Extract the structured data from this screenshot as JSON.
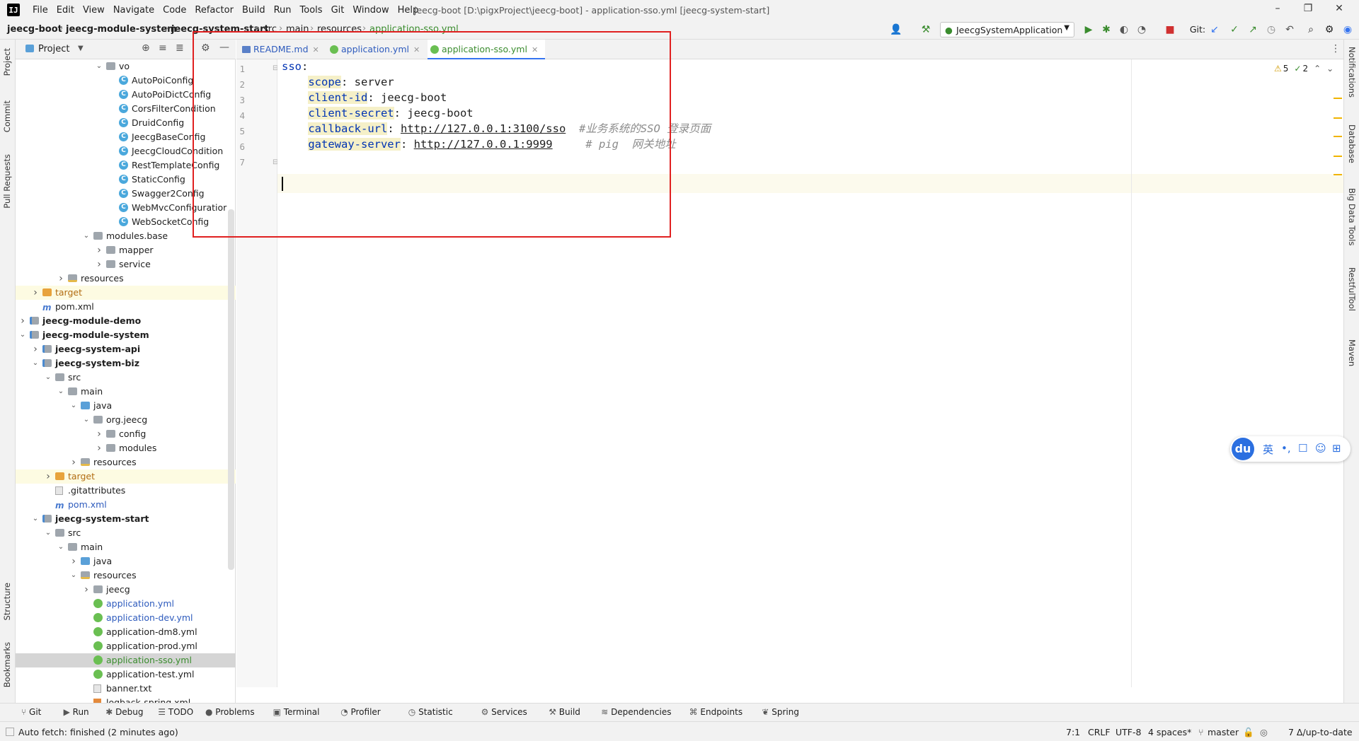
{
  "menu": [
    "File",
    "Edit",
    "View",
    "Navigate",
    "Code",
    "Refactor",
    "Build",
    "Run",
    "Tools",
    "Git",
    "Window",
    "Help"
  ],
  "window_title": "jeecg-boot [D:\\pigxProject\\jeecg-boot] - application-sso.yml [jeecg-system-start]",
  "breadcrumbs": [
    "jeecg-boot",
    "jeecg-module-system",
    "jeecg-system-start",
    "src",
    "main",
    "resources",
    "application-sso.yml"
  ],
  "run_config": "JeecgSystemApplication",
  "git_label": "Git:",
  "left_tools": [
    "Project",
    "Commit",
    "Pull Requests",
    "Structure",
    "Bookmarks"
  ],
  "right_tools": [
    "Notifications",
    "Database",
    "Big Data Tools",
    "RestfulTool",
    "Maven"
  ],
  "project_panel": {
    "title": "Project"
  },
  "tree": [
    {
      "label": "vo",
      "depth": 7,
      "icon": "folder",
      "arrow": "open",
      "style": ""
    },
    {
      "label": "AutoPoiConfig",
      "depth": 8,
      "icon": "class",
      "arrow": "",
      "style": ""
    },
    {
      "label": "AutoPoiDictConfig",
      "depth": 8,
      "icon": "class",
      "arrow": "",
      "style": ""
    },
    {
      "label": "CorsFilterCondition",
      "depth": 8,
      "icon": "class",
      "arrow": "",
      "style": ""
    },
    {
      "label": "DruidConfig",
      "depth": 8,
      "icon": "class",
      "arrow": "",
      "style": ""
    },
    {
      "label": "JeecgBaseConfig",
      "depth": 8,
      "icon": "class",
      "arrow": "",
      "style": ""
    },
    {
      "label": "JeecgCloudCondition",
      "depth": 8,
      "icon": "class",
      "arrow": "",
      "style": ""
    },
    {
      "label": "RestTemplateConfig",
      "depth": 8,
      "icon": "class",
      "arrow": "",
      "style": ""
    },
    {
      "label": "StaticConfig",
      "depth": 8,
      "icon": "class",
      "arrow": "",
      "style": ""
    },
    {
      "label": "Swagger2Config",
      "depth": 8,
      "icon": "class",
      "arrow": "",
      "style": ""
    },
    {
      "label": "WebMvcConfiguratior",
      "depth": 8,
      "icon": "class",
      "arrow": "",
      "style": ""
    },
    {
      "label": "WebSocketConfig",
      "depth": 8,
      "icon": "class",
      "arrow": "",
      "style": ""
    },
    {
      "label": "modules.base",
      "depth": 6,
      "icon": "folder",
      "arrow": "open",
      "style": ""
    },
    {
      "label": "mapper",
      "depth": 7,
      "icon": "folder",
      "arrow": "closed",
      "style": ""
    },
    {
      "label": "service",
      "depth": 7,
      "icon": "folder",
      "arrow": "closed",
      "style": ""
    },
    {
      "label": "resources",
      "depth": 4,
      "icon": "rfolder",
      "arrow": "closed",
      "style": ""
    },
    {
      "label": "target",
      "depth": 2,
      "icon": "ofolder",
      "arrow": "closed",
      "style": "orange",
      "bg": "yel"
    },
    {
      "label": "pom.xml",
      "depth": 2,
      "icon": "maven",
      "arrow": "",
      "style": ""
    },
    {
      "label": "jeecg-module-demo",
      "depth": 1,
      "icon": "mod",
      "arrow": "closed",
      "style": "b"
    },
    {
      "label": "jeecg-module-system",
      "depth": 1,
      "icon": "mod",
      "arrow": "open",
      "style": "b"
    },
    {
      "label": "jeecg-system-api",
      "depth": 2,
      "icon": "mod",
      "arrow": "closed",
      "style": "b"
    },
    {
      "label": "jeecg-system-biz",
      "depth": 2,
      "icon": "mod",
      "arrow": "open",
      "style": "b"
    },
    {
      "label": "src",
      "depth": 3,
      "icon": "folder",
      "arrow": "open",
      "style": ""
    },
    {
      "label": "main",
      "depth": 4,
      "icon": "folder",
      "arrow": "open",
      "style": ""
    },
    {
      "label": "java",
      "depth": 5,
      "icon": "bfolder",
      "arrow": "open",
      "style": ""
    },
    {
      "label": "org.jeecg",
      "depth": 6,
      "icon": "folder",
      "arrow": "open",
      "style": ""
    },
    {
      "label": "config",
      "depth": 7,
      "icon": "folder",
      "arrow": "closed",
      "style": ""
    },
    {
      "label": "modules",
      "depth": 7,
      "icon": "folder",
      "arrow": "closed",
      "style": ""
    },
    {
      "label": "resources",
      "depth": 5,
      "icon": "rfolder",
      "arrow": "closed",
      "style": ""
    },
    {
      "label": "target",
      "depth": 3,
      "icon": "ofolder",
      "arrow": "closed",
      "style": "orange",
      "bg": "yel"
    },
    {
      "label": ".gitattributes",
      "depth": 3,
      "icon": "txt",
      "arrow": "",
      "style": ""
    },
    {
      "label": "pom.xml",
      "depth": 3,
      "icon": "maven",
      "arrow": "",
      "style": "blue"
    },
    {
      "label": "jeecg-system-start",
      "depth": 2,
      "icon": "mod",
      "arrow": "open",
      "style": "b"
    },
    {
      "label": "src",
      "depth": 3,
      "icon": "folder",
      "arrow": "open",
      "style": ""
    },
    {
      "label": "main",
      "depth": 4,
      "icon": "folder",
      "arrow": "open",
      "style": ""
    },
    {
      "label": "java",
      "depth": 5,
      "icon": "bfolder",
      "arrow": "closed",
      "style": ""
    },
    {
      "label": "resources",
      "depth": 5,
      "icon": "rfolder",
      "arrow": "open",
      "style": ""
    },
    {
      "label": "jeecg",
      "depth": 6,
      "icon": "folder",
      "arrow": "closed",
      "style": ""
    },
    {
      "label": "application.yml",
      "depth": 6,
      "icon": "yml",
      "arrow": "",
      "style": "blue"
    },
    {
      "label": "application-dev.yml",
      "depth": 6,
      "icon": "yml",
      "arrow": "",
      "style": "blue"
    },
    {
      "label": "application-dm8.yml",
      "depth": 6,
      "icon": "yml",
      "arrow": "",
      "style": ""
    },
    {
      "label": "application-prod.yml",
      "depth": 6,
      "icon": "yml",
      "arrow": "",
      "style": ""
    },
    {
      "label": "application-sso.yml",
      "depth": 6,
      "icon": "yml",
      "arrow": "",
      "style": "green",
      "bg": "sel"
    },
    {
      "label": "application-test.yml",
      "depth": 6,
      "icon": "yml",
      "arrow": "",
      "style": ""
    },
    {
      "label": "banner.txt",
      "depth": 6,
      "icon": "txt",
      "arrow": "",
      "style": ""
    },
    {
      "label": "logback-spring.xml",
      "depth": 6,
      "icon": "xml",
      "arrow": "",
      "style": ""
    }
  ],
  "tabs": [
    {
      "label": "README.md",
      "active": false
    },
    {
      "label": "application.yml",
      "active": false
    },
    {
      "label": "application-sso.yml",
      "active": true
    }
  ],
  "inspections": {
    "warnings": "5",
    "ok": "2"
  },
  "code": {
    "line_numbers": [
      "1",
      "2",
      "3",
      "4",
      "5",
      "6",
      "7"
    ],
    "lines": [
      [
        {
          "t": "sso",
          "c": "k0"
        },
        {
          "t": ":",
          "c": "v"
        }
      ],
      [
        {
          "t": "    ",
          "c": "v"
        },
        {
          "t": "scope",
          "c": "k"
        },
        {
          "t": ": server",
          "c": "v"
        }
      ],
      [
        {
          "t": "    ",
          "c": "v"
        },
        {
          "t": "client-id",
          "c": "k"
        },
        {
          "t": ": jeecg-boot",
          "c": "v"
        }
      ],
      [
        {
          "t": "    ",
          "c": "v"
        },
        {
          "t": "client-secret",
          "c": "k"
        },
        {
          "t": ": jeecg-boot",
          "c": "v"
        }
      ],
      [
        {
          "t": "    ",
          "c": "v"
        },
        {
          "t": "callback-url",
          "c": "k"
        },
        {
          "t": ": ",
          "c": "v"
        },
        {
          "t": "http://127.0.0.1:3100/sso",
          "c": "url"
        },
        {
          "t": "  #业务系统的SSO 登录页面",
          "c": "cm"
        }
      ],
      [
        {
          "t": "    ",
          "c": "v"
        },
        {
          "t": "gateway-server",
          "c": "k"
        },
        {
          "t": ": ",
          "c": "v"
        },
        {
          "t": "http://127.0.0.1:9999",
          "c": "url"
        },
        {
          "t": "     # pig  网关地址",
          "c": "cm"
        }
      ],
      []
    ]
  },
  "bottom_tools": [
    "Git",
    "Run",
    "Debug",
    "TODO",
    "Problems",
    "Terminal",
    "Profiler",
    "Statistic",
    "Services",
    "Build",
    "Dependencies",
    "Endpoints",
    "Spring"
  ],
  "status": {
    "message": "Auto fetch: finished (2 minutes ago)",
    "position": "7:1",
    "line_sep": "CRLF",
    "encoding": "UTF-8",
    "indent": "4 spaces*",
    "branch": "master",
    "updates": "7 Δ/up-to-date"
  },
  "ime": {
    "logo": "du",
    "buttons": [
      "英",
      "•,",
      "☐",
      "☺",
      "⊞"
    ]
  },
  "colors": {
    "accent": "#3574f0",
    "highlight_box": "#e02020",
    "key": "#0033b3",
    "comment": "#8c8c8c"
  }
}
